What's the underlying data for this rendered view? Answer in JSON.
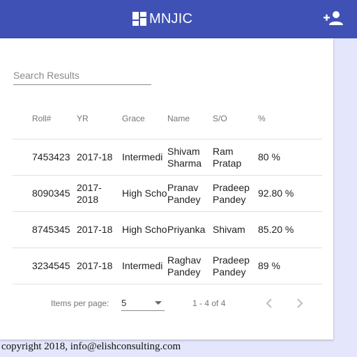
{
  "app": {
    "title": "MNJIC"
  },
  "icons": {
    "logo": "dashboard-logo-icon",
    "add_user": "person-add-icon",
    "prev": "chevron-left-icon",
    "next": "chevron-right-icon",
    "dropdown": "arrow-drop-down-icon"
  },
  "colors": {
    "toolbar": "#3f51b5",
    "background": "#e4e6fb"
  },
  "search": {
    "placeholder": "Search Results",
    "value": ""
  },
  "table": {
    "columns": [
      "Roll#",
      "YR",
      "Grace",
      "Name",
      "S/O",
      "%"
    ],
    "rows": [
      {
        "roll": "7453423",
        "yr": "2017-18",
        "grade": "Intermedi",
        "name": "Shivam Sharma",
        "so": "Ram Pratap",
        "pct": "80 %"
      },
      {
        "roll": "8090345",
        "yr": "2017-2018",
        "grade": "High School",
        "name": "Pranav Pandey",
        "so": "Pradeep Pandey",
        "pct": "92.80 %"
      },
      {
        "roll": "8745345",
        "yr": "2017-18",
        "grade": "High School",
        "name": "Priyanka",
        "so": "Shivam",
        "pct": "85.20 %"
      },
      {
        "roll": "3234545",
        "yr": "2017-18",
        "grade": "Intermedi",
        "name": "Raghav Pandey",
        "so": "Pradeep Pandey",
        "pct": "89 %"
      }
    ]
  },
  "paginator": {
    "label": "Items per page:",
    "page_size": "5",
    "range": "1 - 4 of 4"
  },
  "footer": {
    "text": "copyright 2018, info@elishconsulting.com"
  }
}
